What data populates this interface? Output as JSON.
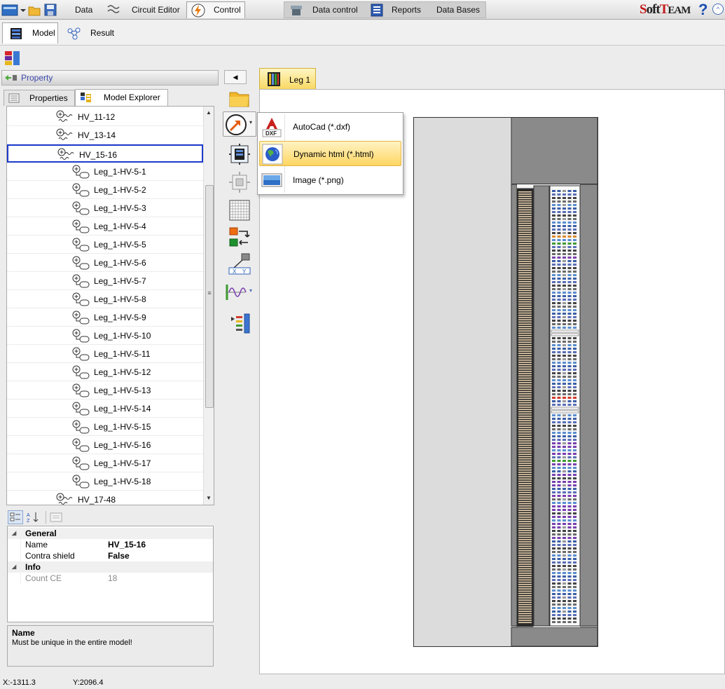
{
  "menubar": {
    "tabs": [
      {
        "label": "Data"
      },
      {
        "label": "Circuit Editor"
      },
      {
        "label": "Control"
      },
      {
        "label": "Data control"
      },
      {
        "label": "Reports"
      },
      {
        "label": "Data Bases"
      }
    ],
    "brand": "SoftTEAM",
    "help": "?",
    "expand": "^"
  },
  "subtabs": [
    {
      "label": "Model"
    },
    {
      "label": "Result"
    }
  ],
  "left_panel": {
    "property_header": "Property",
    "tabs": [
      {
        "label": "Properties"
      },
      {
        "label": "Model Explorer"
      }
    ],
    "tree": [
      {
        "label": "HV_11-12",
        "level": 1
      },
      {
        "label": "HV_13-14",
        "level": 1
      },
      {
        "label": "HV_15-16",
        "level": 1,
        "selected": true
      },
      {
        "label": "Leg_1-HV-5-1",
        "level": 2
      },
      {
        "label": "Leg_1-HV-5-2",
        "level": 2
      },
      {
        "label": "Leg_1-HV-5-3",
        "level": 2
      },
      {
        "label": "Leg_1-HV-5-4",
        "level": 2
      },
      {
        "label": "Leg_1-HV-5-5",
        "level": 2
      },
      {
        "label": "Leg_1-HV-5-6",
        "level": 2
      },
      {
        "label": "Leg_1-HV-5-7",
        "level": 2
      },
      {
        "label": "Leg_1-HV-5-8",
        "level": 2
      },
      {
        "label": "Leg_1-HV-5-9",
        "level": 2
      },
      {
        "label": "Leg_1-HV-5-10",
        "level": 2
      },
      {
        "label": "Leg_1-HV-5-11",
        "level": 2
      },
      {
        "label": "Leg_1-HV-5-12",
        "level": 2
      },
      {
        "label": "Leg_1-HV-5-13",
        "level": 2
      },
      {
        "label": "Leg_1-HV-5-14",
        "level": 2
      },
      {
        "label": "Leg_1-HV-5-15",
        "level": 2
      },
      {
        "label": "Leg_1-HV-5-16",
        "level": 2
      },
      {
        "label": "Leg_1-HV-5-17",
        "level": 2
      },
      {
        "label": "Leg_1-HV-5-18",
        "level": 2
      },
      {
        "label": "HV_17-48",
        "level": 1
      }
    ],
    "scroll_grip": "≡",
    "property_grid": {
      "general": {
        "category": "General",
        "name_label": "Name",
        "name_value": "HV_15-16",
        "contra_label": "Contra shield",
        "contra_value": "False"
      },
      "info": {
        "category": "Info",
        "count_label": "Count CE",
        "count_value": "18"
      }
    },
    "description": {
      "title": "Name",
      "text": "Must be unique in the entire model!"
    }
  },
  "status": {
    "x": "X:-1311.3",
    "y": "Y:2096.4"
  },
  "export_menu": {
    "items": [
      {
        "label": "AutoCad (*.dxf)",
        "icon": "dxf-icon"
      },
      {
        "label": "Dynamic html (*.html)",
        "icon": "globe-icon"
      },
      {
        "label": "Image (*.png)",
        "icon": "image-icon"
      }
    ],
    "dxf_badge": "DXF"
  },
  "vtools": {
    "axis_x": "X",
    "axis_y": "Y"
  },
  "canvas": {
    "tab_label": "Leg 1"
  },
  "colors": {
    "accent_tab": "#f8d760",
    "selection_border": "#1d3ccc",
    "menu_hover": "#ffd662"
  }
}
